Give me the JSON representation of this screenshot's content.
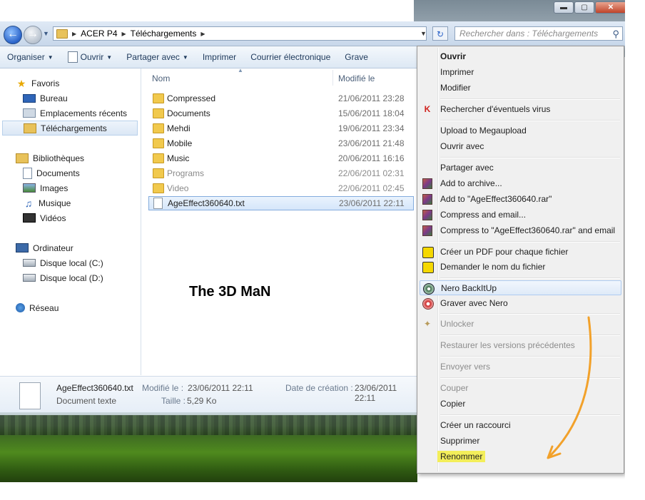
{
  "window": {
    "caption": {
      "minimize": "▬",
      "maximize": "▢",
      "close": "✕"
    },
    "address": {
      "crumbs": [
        "ACER P4",
        "Téléchargements"
      ]
    },
    "search": {
      "placeholder": "Rechercher dans : Téléchargements"
    }
  },
  "toolbar": {
    "organize": "Organiser",
    "open": "Ouvrir",
    "share": "Partager avec",
    "print": "Imprimer",
    "email": "Courrier électronique",
    "burn": "Grave"
  },
  "sidebar": {
    "favorites": "Favoris",
    "desktop": "Bureau",
    "recent": "Emplacements récents",
    "downloads": "Téléchargements",
    "libraries": "Bibliothèques",
    "documents": "Documents",
    "images": "Images",
    "music": "Musique",
    "videos": "Vidéos",
    "computer": "Ordinateur",
    "disk_c": "Disque local (C:)",
    "disk_d": "Disque local (D:)",
    "network": "Réseau"
  },
  "filelist": {
    "col_name": "Nom",
    "col_modified": "Modifié le",
    "files": [
      {
        "name": "Compressed",
        "date": "21/06/2011 23:28"
      },
      {
        "name": "Documents",
        "date": "15/06/2011 18:04"
      },
      {
        "name": "Mehdi",
        "date": "19/06/2011 23:34"
      },
      {
        "name": "Mobile",
        "date": "23/06/2011 21:48"
      },
      {
        "name": "Music",
        "date": "20/06/2011 16:16"
      },
      {
        "name": "Programs",
        "date": "22/06/2011 02:31"
      },
      {
        "name": "Video",
        "date": "22/06/2011 02:45"
      },
      {
        "name": "AgeEffect360640.txt",
        "date": "23/06/2011 22:11"
      }
    ],
    "caption": "The 3D MaN"
  },
  "details": {
    "name": "AgeEffect360640.txt",
    "type": "Document texte",
    "modified_label": "Modifié le :",
    "modified_value": "23/06/2011 22:11",
    "created_label": "Date de création :",
    "created_value": "23/06/2011 22:11",
    "size_label": "Taille :",
    "size_value": "5,29 Ko"
  },
  "context_menu": {
    "open": "Ouvrir",
    "print": "Imprimer",
    "edit": "Modifier",
    "scan": "Rechercher d'éventuels virus",
    "upload": "Upload to Megaupload",
    "open_with": "Ouvrir avec",
    "share_with": "Partager avec",
    "add_archive": "Add to archive...",
    "add_rar": "Add to \"AgeEffect360640.rar\"",
    "compress_email": "Compress and email...",
    "compress_rar_email": "Compress to \"AgeEffect360640.rar\" and email",
    "pdf_each": "Créer un PDF pour chaque fichier",
    "pdf_ask": "Demander le nom du fichier",
    "nero_backup": "Nero BackItUp",
    "nero_burn": "Graver avec Nero",
    "unlocker": "Unlocker",
    "restore": "Restaurer les versions précédentes",
    "send_to": "Envoyer vers",
    "cut": "Couper",
    "copy": "Copier",
    "shortcut": "Créer un raccourci",
    "delete": "Supprimer",
    "rename": "Renommer"
  },
  "colors": {
    "accent_arrow": "#f2a12a",
    "rename_highlight": "#f3ee5a"
  }
}
